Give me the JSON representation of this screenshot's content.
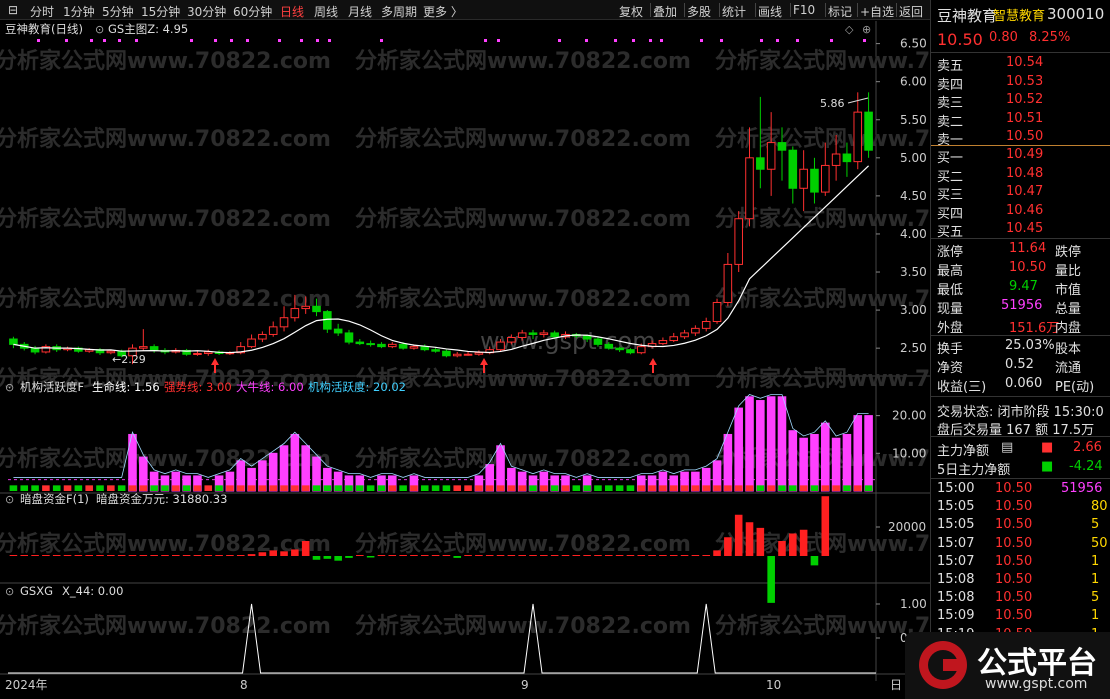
{
  "toolbar": {
    "left": [
      "分时",
      "1分钟",
      "5分钟",
      "15分钟",
      "30分钟",
      "60分钟",
      "日线",
      "周线",
      "月线",
      "多周期",
      "更多 〉"
    ],
    "active": "日线",
    "right": [
      "复权",
      "叠加",
      "多股",
      "统计",
      "画线",
      "F10",
      "标记",
      "+自选",
      "返回"
    ]
  },
  "main_header": {
    "name": "豆神教育(日线)",
    "indicator": "GS主图Z",
    "value": ": 4.95"
  },
  "main_price_labels": [
    "6.50",
    "6.00",
    "5.50",
    "5.00",
    "4.50",
    "4.00",
    "3.50",
    "3.00",
    "2.50"
  ],
  "annotations": {
    "high": "5.86",
    "low": "2.29"
  },
  "ind1": {
    "title": "机构活跃度F",
    "l1": "生命线: 1.56",
    "l2": "强势线: 3.00",
    "l3": "大牛线: 6.00",
    "l4": "机构活跃度: 20.02",
    "axis": [
      "20.00",
      "10.00"
    ]
  },
  "ind2": {
    "title": "暗盘资金F(1)",
    "l1": "暗盘资金万元: 31880.33",
    "axis": [
      "20000"
    ]
  },
  "ind3": {
    "title": "GSXG",
    "l1": "X_44: 0.00",
    "axis": [
      "1.00",
      "0.50"
    ]
  },
  "xaxis": {
    "year": "2024年",
    "m8": "8",
    "m9": "9",
    "m10": "10",
    "end": "日"
  },
  "watermarks": [
    "分析家公式网www.70822.com"
  ],
  "wm_gspt": "www.gspt.com",
  "colors": {
    "up": "#ff3030",
    "down": "#00d000",
    "line": "#ffffff",
    "mag": "#ff40ff"
  },
  "chart_data": {
    "type": "candlestick",
    "ylim": [
      2.2,
      6.6
    ],
    "candles": [
      [
        2.62,
        2.55,
        2.65,
        2.5
      ],
      [
        2.55,
        2.5,
        2.58,
        2.47
      ],
      [
        2.5,
        2.45,
        2.53,
        2.42
      ],
      [
        2.45,
        2.52,
        2.55,
        2.43
      ],
      [
        2.52,
        2.48,
        2.55,
        2.45
      ],
      [
        2.48,
        2.5,
        2.52,
        2.46
      ],
      [
        2.5,
        2.46,
        2.52,
        2.44
      ],
      [
        2.46,
        2.48,
        2.5,
        2.44
      ],
      [
        2.48,
        2.44,
        2.5,
        2.41
      ],
      [
        2.44,
        2.46,
        2.48,
        2.42
      ],
      [
        2.46,
        2.4,
        2.48,
        2.38
      ],
      [
        2.4,
        2.5,
        2.55,
        2.29
      ],
      [
        2.5,
        2.52,
        2.75,
        2.47
      ],
      [
        2.52,
        2.47,
        2.55,
        2.44
      ],
      [
        2.47,
        2.45,
        2.5,
        2.42
      ],
      [
        2.45,
        2.47,
        2.5,
        2.43
      ],
      [
        2.47,
        2.42,
        2.49,
        2.4
      ],
      [
        2.42,
        2.43,
        2.46,
        2.4
      ],
      [
        2.43,
        2.45,
        2.48,
        2.4
      ],
      [
        2.45,
        2.43,
        2.47,
        2.41
      ],
      [
        2.43,
        2.44,
        2.46,
        2.41
      ],
      [
        2.44,
        2.52,
        2.58,
        2.42
      ],
      [
        2.52,
        2.62,
        2.68,
        2.5
      ],
      [
        2.62,
        2.68,
        2.72,
        2.58
      ],
      [
        2.68,
        2.78,
        2.85,
        2.65
      ],
      [
        2.78,
        2.9,
        3.05,
        2.72
      ],
      [
        2.9,
        3.02,
        3.2,
        2.85
      ],
      [
        3.02,
        3.05,
        3.18,
        2.95
      ],
      [
        3.05,
        2.98,
        3.15,
        2.92
      ],
      [
        2.98,
        2.75,
        3.0,
        2.7
      ],
      [
        2.75,
        2.7,
        2.82,
        2.66
      ],
      [
        2.7,
        2.58,
        2.74,
        2.55
      ],
      [
        2.58,
        2.56,
        2.62,
        2.54
      ],
      [
        2.56,
        2.55,
        2.6,
        2.52
      ],
      [
        2.55,
        2.52,
        2.58,
        2.5
      ],
      [
        2.52,
        2.55,
        2.58,
        2.5
      ],
      [
        2.55,
        2.5,
        2.58,
        2.48
      ],
      [
        2.5,
        2.52,
        2.55,
        2.48
      ],
      [
        2.52,
        2.48,
        2.55,
        2.46
      ],
      [
        2.48,
        2.46,
        2.51,
        2.44
      ],
      [
        2.46,
        2.4,
        2.48,
        2.38
      ],
      [
        2.4,
        2.42,
        2.45,
        2.38
      ],
      [
        2.42,
        2.42,
        2.45,
        2.4
      ],
      [
        2.42,
        2.44,
        2.47,
        2.4
      ],
      [
        2.44,
        2.48,
        2.52,
        2.42
      ],
      [
        2.48,
        2.58,
        2.62,
        2.46
      ],
      [
        2.58,
        2.64,
        2.68,
        2.55
      ],
      [
        2.64,
        2.7,
        2.74,
        2.6
      ],
      [
        2.7,
        2.68,
        2.74,
        2.62
      ],
      [
        2.68,
        2.7,
        2.74,
        2.64
      ],
      [
        2.7,
        2.65,
        2.73,
        2.62
      ],
      [
        2.65,
        2.68,
        2.72,
        2.62
      ],
      [
        2.68,
        2.66,
        2.7,
        2.63
      ],
      [
        2.66,
        2.62,
        2.68,
        2.58
      ],
      [
        2.62,
        2.55,
        2.64,
        2.52
      ],
      [
        2.55,
        2.5,
        2.58,
        2.48
      ],
      [
        2.5,
        2.48,
        2.52,
        2.45
      ],
      [
        2.48,
        2.44,
        2.5,
        2.42
      ],
      [
        2.44,
        2.52,
        2.56,
        2.42
      ],
      [
        2.52,
        2.56,
        2.6,
        2.5
      ],
      [
        2.56,
        2.6,
        2.64,
        2.54
      ],
      [
        2.6,
        2.65,
        2.7,
        2.58
      ],
      [
        2.65,
        2.7,
        2.74,
        2.62
      ],
      [
        2.7,
        2.76,
        2.8,
        2.66
      ],
      [
        2.76,
        2.85,
        2.9,
        2.72
      ],
      [
        2.85,
        3.1,
        3.15,
        2.82
      ],
      [
        3.1,
        3.6,
        3.75,
        3.05
      ],
      [
        3.6,
        4.2,
        4.3,
        3.5
      ],
      [
        4.2,
        5.0,
        5.4,
        4.1
      ],
      [
        5.0,
        4.85,
        5.8,
        4.6
      ],
      [
        4.85,
        5.2,
        5.6,
        4.5
      ],
      [
        5.2,
        5.1,
        5.4,
        4.7
      ],
      [
        5.1,
        4.6,
        5.15,
        4.4
      ],
      [
        4.6,
        4.85,
        5.1,
        4.3
      ],
      [
        4.85,
        4.55,
        5.0,
        4.4
      ],
      [
        4.55,
        4.9,
        5.2,
        4.5
      ],
      [
        4.9,
        5.05,
        5.3,
        4.7
      ],
      [
        5.05,
        4.95,
        5.2,
        4.75
      ],
      [
        4.95,
        5.6,
        5.86,
        4.85
      ],
      [
        5.6,
        5.1,
        5.86,
        5.0
      ]
    ],
    "ind1_bars": [
      3,
      3,
      3,
      3,
      3,
      3,
      3,
      3,
      3,
      3,
      3,
      15,
      9,
      5,
      4,
      5,
      4,
      4,
      3,
      4,
      5,
      8,
      6,
      8,
      10,
      12,
      15,
      12,
      9,
      6,
      5,
      4,
      4,
      3,
      4,
      4,
      3,
      4,
      3,
      3,
      3,
      3,
      3,
      4,
      7,
      12,
      6,
      5,
      4,
      5,
      4,
      4,
      3,
      4,
      3,
      3,
      3,
      3,
      4,
      4,
      5,
      4,
      5,
      5,
      6,
      8,
      15,
      22,
      25,
      24,
      25,
      25,
      16,
      14,
      15,
      18,
      14,
      15,
      20,
      20
    ],
    "ind2_bars": [
      0,
      0,
      0,
      0,
      0,
      0,
      0,
      0,
      0,
      0,
      0,
      0,
      0,
      0,
      0,
      0,
      0,
      0,
      0,
      0,
      0,
      0,
      1000,
      2000,
      3000,
      2500,
      3500,
      8000,
      -2000,
      -1500,
      -2500,
      -1000,
      0,
      -800,
      0,
      0,
      0,
      0,
      0,
      0,
      0,
      -1000,
      0,
      0,
      0,
      0,
      0,
      0,
      0,
      0,
      0,
      0,
      0,
      0,
      0,
      0,
      0,
      0,
      0,
      0,
      0,
      0,
      0,
      0,
      0,
      3000,
      10000,
      22000,
      18000,
      15000,
      -25000,
      8000,
      12000,
      14000,
      -5000,
      31880
    ],
    "ind3_peaks": [
      22,
      48,
      64
    ]
  },
  "side": {
    "name": "豆神教育",
    "sector": "智慧教育",
    "code": "300010",
    "price": "10.50",
    "change": "0.80",
    "pct": "8.25%",
    "asks": [
      [
        "卖五",
        "10.54"
      ],
      [
        "卖四",
        "10.53"
      ],
      [
        "卖三",
        "10.52"
      ],
      [
        "卖二",
        "10.51"
      ],
      [
        "卖一",
        "10.50"
      ]
    ],
    "bids": [
      [
        "买一",
        "10.49"
      ],
      [
        "买二",
        "10.48"
      ],
      [
        "买三",
        "10.47"
      ],
      [
        "买四",
        "10.46"
      ],
      [
        "买五",
        "10.45"
      ]
    ],
    "stats": [
      [
        "涨停",
        "11.64",
        "跌停"
      ],
      [
        "最高",
        "10.50",
        "量比"
      ],
      [
        "最低",
        "9.47",
        "市值"
      ],
      [
        "现量",
        "51956",
        "总量"
      ],
      [
        "外盘",
        "151.6万",
        "内盘"
      ]
    ],
    "stats2": [
      [
        "换手",
        "25.03%",
        "股本"
      ],
      [
        "净资",
        "0.52",
        "流通"
      ],
      [
        "收益(三)",
        "0.060",
        "PE(动)"
      ]
    ],
    "trade_state": "交易状态: 闭市阶段  15:30:0",
    "after": "盘后交易量 167 额 17.5万",
    "main_net": "主力净额",
    "main_net_v": "2.66",
    "main5": "5日主力净额",
    "main5_v": "-4.24",
    "ticks": [
      [
        "15:00",
        "10.50",
        "51956"
      ],
      [
        "15:05",
        "10.50",
        "80"
      ],
      [
        "15:05",
        "10.50",
        "5"
      ],
      [
        "15:07",
        "10.50",
        "50"
      ],
      [
        "15:07",
        "10.50",
        "1"
      ],
      [
        "15:08",
        "10.50",
        "1"
      ],
      [
        "15:08",
        "10.50",
        "5"
      ],
      [
        "15:09",
        "10.50",
        "1"
      ],
      [
        "15:19",
        "10.50",
        "1"
      ]
    ],
    "logo_text": "公式平台",
    "logo_url": "www.gspt.com"
  }
}
